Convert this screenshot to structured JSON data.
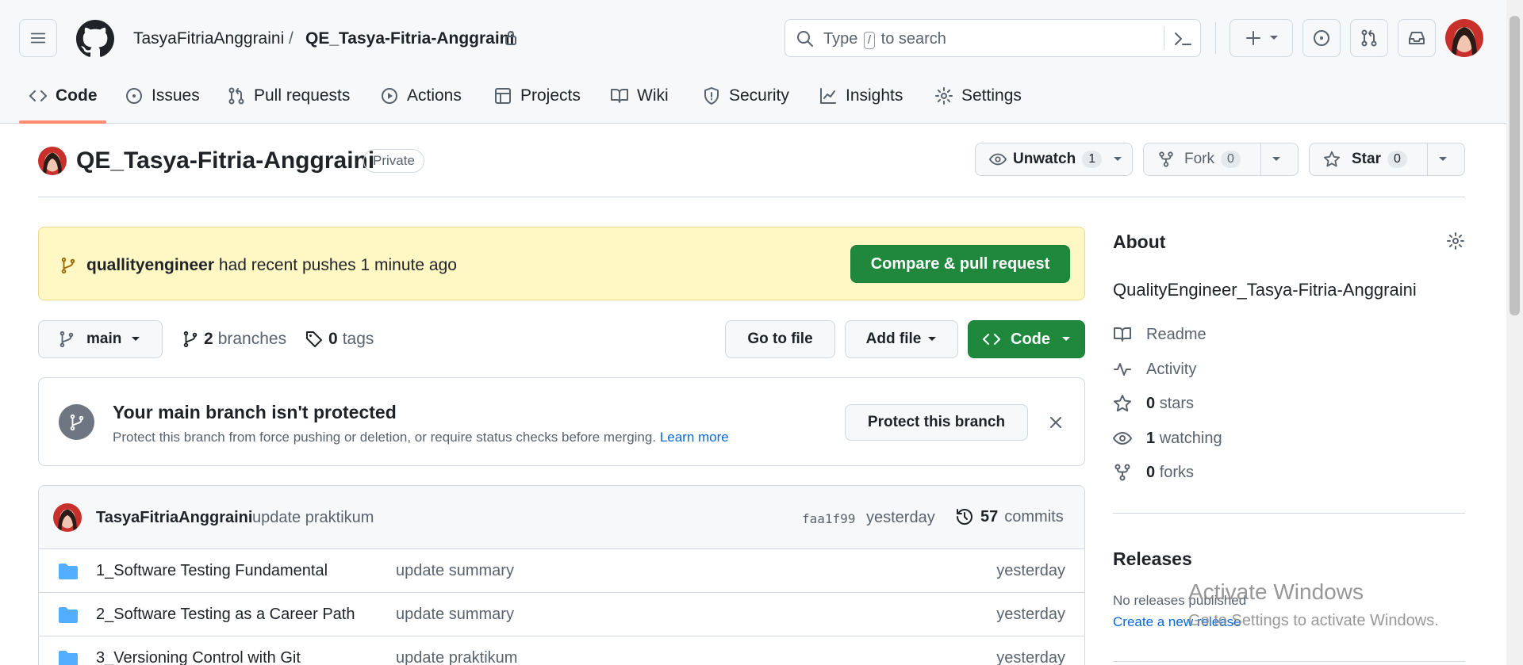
{
  "header": {
    "owner": "TasyaFitriaAnggraini",
    "separator": "/",
    "repo": "QE_Tasya-Fitria-Anggraini",
    "search_prefix": "Type",
    "search_key": "/",
    "search_suffix": "to search"
  },
  "nav": {
    "tabs": [
      {
        "label": "Code",
        "icon": "code-icon"
      },
      {
        "label": "Issues",
        "icon": "issue-icon"
      },
      {
        "label": "Pull requests",
        "icon": "pull-request-icon"
      },
      {
        "label": "Actions",
        "icon": "play-icon"
      },
      {
        "label": "Projects",
        "icon": "table-icon"
      },
      {
        "label": "Wiki",
        "icon": "book-icon"
      },
      {
        "label": "Security",
        "icon": "shield-icon"
      },
      {
        "label": "Insights",
        "icon": "graph-icon"
      },
      {
        "label": "Settings",
        "icon": "gear-icon"
      }
    ]
  },
  "repo_header": {
    "title": "QE_Tasya-Fitria-Anggraini",
    "visibility": "Private",
    "watch_label": "Unwatch",
    "watch_count": "1",
    "fork_label": "Fork",
    "fork_count": "0",
    "star_label": "Star",
    "star_count": "0"
  },
  "push_banner": {
    "user": "quallityengineer",
    "message": "had recent pushes 1 minute ago",
    "button": "Compare & pull request"
  },
  "branch_bar": {
    "branch": "main",
    "branches_count": "2",
    "branches_label": "branches",
    "tags_count": "0",
    "tags_label": "tags",
    "go_to_file": "Go to file",
    "add_file": "Add file",
    "code": "Code"
  },
  "protect": {
    "title": "Your main branch isn't protected",
    "description": "Protect this branch from force pushing or deletion, or require status checks before merging.",
    "learn_more": "Learn more",
    "button": "Protect this branch"
  },
  "latest_commit": {
    "author": "TasyaFitriaAnggraini",
    "message": "update praktikum",
    "sha": "faa1f99",
    "time": "yesterday",
    "commits_count": "57",
    "commits_label": "commits"
  },
  "files": [
    {
      "name": "1_Software Testing Fundamental",
      "message": "update summary",
      "date": "yesterday"
    },
    {
      "name": "2_Software Testing as a Career Path",
      "message": "update summary",
      "date": "yesterday"
    },
    {
      "name": "3_Versioning Control with Git",
      "message": "update praktikum",
      "date": "yesterday"
    }
  ],
  "about": {
    "heading": "About",
    "description": "QualityEngineer_Tasya-Fitria-Anggraini",
    "readme": "Readme",
    "activity": "Activity",
    "stars_count": "0",
    "stars_label": "stars",
    "watching_count": "1",
    "watching_label": "watching",
    "forks_count": "0",
    "forks_label": "forks"
  },
  "releases": {
    "heading": "Releases",
    "none": "No releases published",
    "create": "Create a new release"
  },
  "watermark": {
    "line1": "Activate Windows",
    "line2": "Go to Settings to activate Windows."
  },
  "colors": {
    "accent_green": "#1f883d",
    "link_blue": "#0969da",
    "banner_yellow": "#fff8c5",
    "tab_underline": "#fd8c73",
    "folder_blue": "#54aeff"
  }
}
